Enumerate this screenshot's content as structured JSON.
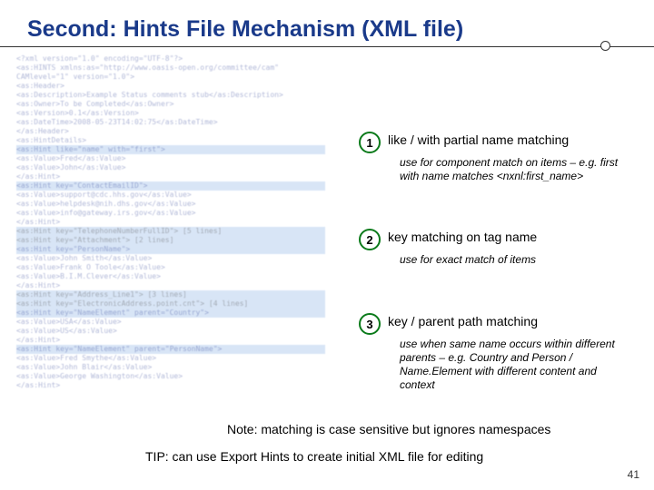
{
  "slide": {
    "title": "Second: Hints File Mechanism (XML file)",
    "number": "41"
  },
  "annotations": [
    {
      "num": "1",
      "heading": "like / with partial name matching",
      "sub": "use for component match on items – e.g. first with name matches <nxnl:first_name>"
    },
    {
      "num": "2",
      "heading": "key matching on tag name",
      "sub": "use for exact match of items"
    },
    {
      "num": "3",
      "heading": "key / parent path matching",
      "sub": "use when same name occurs within different parents – e.g. Country and Person / Name.Element with different content and context"
    }
  ],
  "note": "Note: matching is case sensitive but ignores namespaces",
  "tip": "TIP: can use Export Hints to create initial XML file for editing",
  "xml_lines": [
    "<?xml version=\"1.0\" encoding=\"UTF-8\"?>",
    "<as:HINTS xmlns:as=\"http://www.oasis-open.org/committee/cam\" CAMlevel=\"1\" version=\"1.0\">",
    " <as:Header>",
    "  <as:Description>Example Status comments stub</as:Description>",
    "  <as:Owner>To be Completed</as:Owner>",
    "  <as:Version>0.1</as:Version>",
    "  <as:DateTime>2008-05-23T14:02:75</as:DateTime>",
    " </as:Header>",
    " <as:HintDetails>",
    "  <as:Hint like=\"name\" with=\"first\">",
    "   <as:Value>Fred</as:Value>",
    "   <as:Value>John</as:Value>",
    "  </as:Hint>",
    "  <as:Hint key=\"ContactEmailID\">",
    "   <as:Value>support@cdc.hhs.gov</as:Value>",
    "   <as:Value>helpdesk@nih.dhs.gov</as:Value>",
    "   <as:Value>info@gateway.irs.gov</as:Value>",
    "  </as:Hint>",
    "  <as:Hint key=\"TelephoneNumberFullID\"> [5 lines]",
    "  <as:Hint key=\"Attachment\"> [2 lines]",
    "  <as:Hint key=\"PersonName\">",
    "   <as:Value>John Smith</as:Value>",
    "   <as:Value>Frank O Toole</as:Value>",
    "   <as:Value>B.I.M.Clever</as:Value>",
    "  </as:Hint>",
    "  <as:Hint key=\"Address_Line1\"> [3 lines]",
    "  <as:Hint key=\"ElectronicAddress.point.cnt\"> [4 lines]",
    "  <as:Hint key=\"NameElement\" parent=\"Country\">",
    "   <as:Value>USA</as:Value>",
    "   <as:Value>US</as:Value>",
    "  </as:Hint>",
    "  <as:Hint key=\"NameElement\" parent=\"PersonName\">",
    "   <as:Value>Fred Smythe</as:Value>",
    "   <as:Value>John Blair</as:Value>",
    "   <as:Value>George Washington</as:Value>",
    "  </as:Hint>"
  ]
}
